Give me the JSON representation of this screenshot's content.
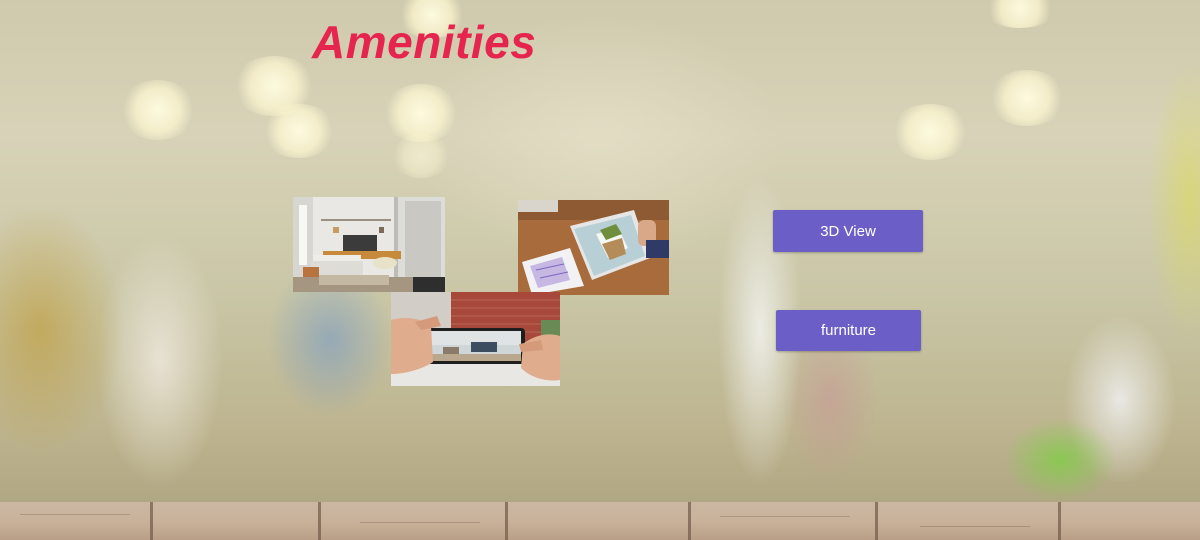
{
  "page": {
    "title": "Amenities",
    "title_color": "#e6254f"
  },
  "gallery": [
    {
      "subject": "living-room interior photo"
    },
    {
      "subject": "tablet showing 3D house model over floor plan"
    },
    {
      "subject": "phone held in hands showing AR room view"
    }
  ],
  "actions": {
    "view_3d_label": "3D View",
    "furniture_label": "furniture",
    "button_color": "#6b5fc7"
  }
}
